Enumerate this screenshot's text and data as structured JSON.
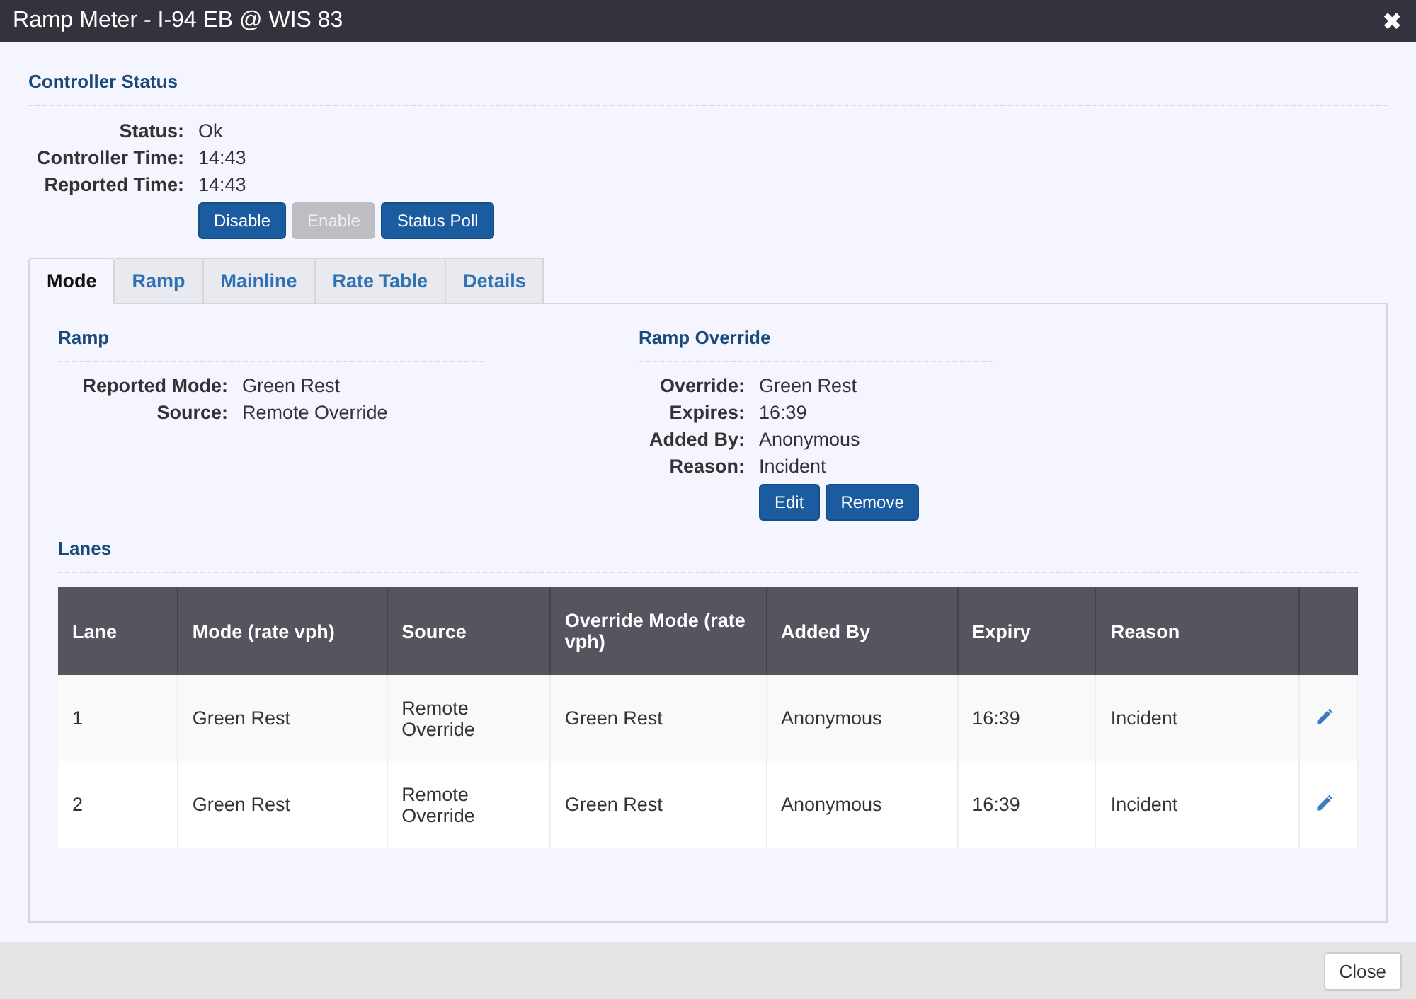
{
  "window": {
    "title": "Ramp Meter - I-94 EB @ WIS 83",
    "close_icon": "✖"
  },
  "controller_status": {
    "heading": "Controller Status",
    "fields": [
      {
        "label": "Status:",
        "value": "Ok"
      },
      {
        "label": "Controller Time:",
        "value": "14:43"
      },
      {
        "label": "Reported Time:",
        "value": "14:43"
      }
    ],
    "buttons": [
      {
        "label": "Disable",
        "disabled": false
      },
      {
        "label": "Enable",
        "disabled": true
      },
      {
        "label": "Status Poll",
        "disabled": false
      }
    ]
  },
  "tabs": [
    {
      "label": "Mode",
      "selected": true
    },
    {
      "label": "Ramp",
      "selected": false
    },
    {
      "label": "Mainline",
      "selected": false
    },
    {
      "label": "Rate Table",
      "selected": false
    },
    {
      "label": "Details",
      "selected": false
    }
  ],
  "ramp": {
    "heading": "Ramp",
    "fields": [
      {
        "label": "Reported Mode:",
        "value": "Green Rest"
      },
      {
        "label": "Source:",
        "value": "Remote Override"
      }
    ]
  },
  "ramp_override": {
    "heading": "Ramp Override",
    "fields": [
      {
        "label": "Override:",
        "value": "Green Rest"
      },
      {
        "label": "Expires:",
        "value": "16:39"
      },
      {
        "label": "Added By:",
        "value": "Anonymous"
      },
      {
        "label": "Reason:",
        "value": "Incident"
      }
    ],
    "buttons": [
      {
        "label": "Edit",
        "disabled": false
      },
      {
        "label": "Remove",
        "disabled": false
      }
    ]
  },
  "lanes": {
    "heading": "Lanes",
    "columns": [
      "Lane",
      "Mode (rate vph)",
      "Source",
      "Override Mode (rate vph)",
      "Added By",
      "Expiry",
      "Reason"
    ],
    "rows": [
      {
        "cells": [
          "1",
          "Green Rest",
          "Remote Override",
          "Green Rest",
          "Anonymous",
          "16:39",
          "Incident"
        ]
      },
      {
        "cells": [
          "2",
          "Green Rest",
          "Remote Override",
          "Green Rest",
          "Anonymous",
          "16:39",
          "Incident"
        ]
      }
    ]
  },
  "footer": {
    "close_button": "Close"
  }
}
